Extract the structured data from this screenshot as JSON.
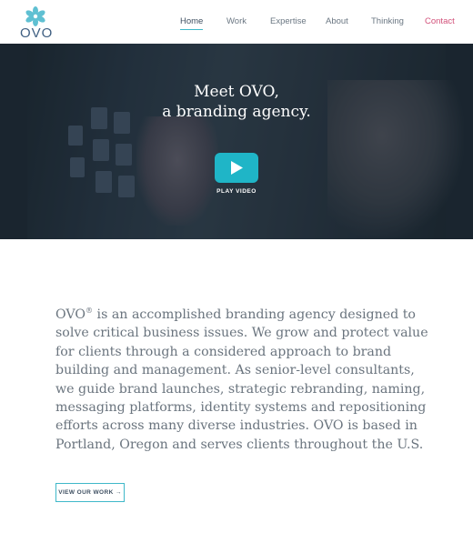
{
  "brand": {
    "logo_text": "OVO",
    "accent": "#1fb5c7",
    "contact_color": "#d2517a"
  },
  "nav": {
    "items": [
      {
        "label": "Home",
        "active": true
      },
      {
        "label": "Work"
      },
      {
        "label": "Expertise"
      },
      {
        "label": "About"
      },
      {
        "label": "Thinking"
      },
      {
        "label": "Contact"
      }
    ]
  },
  "hero": {
    "title_line1": "Meet OVO,",
    "title_line2": "a branding agency.",
    "play_label": "PLAY VIDEO"
  },
  "intro": {
    "brand": "OVO",
    "registered": "®",
    "text": " is an accomplished branding agency designed to solve critical business issues. We grow and protect value for clients through a considered approach to brand building and management. As senior-level consultants, we guide brand launches, strategic rebranding, naming, messaging platforms, identity systems and repositioning efforts across many diverse industries. OVO is based in Portland, Oregon and serves clients throughout the U.S."
  },
  "cta": {
    "label": "VIEW OUR WORK →"
  }
}
